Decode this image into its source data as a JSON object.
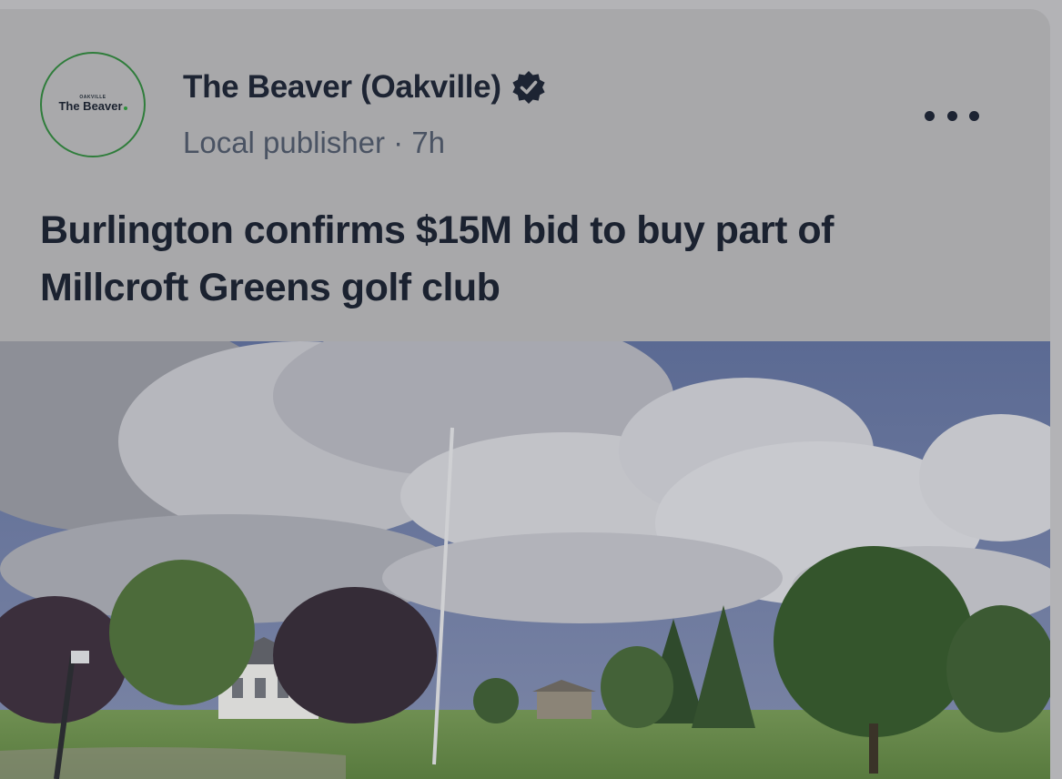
{
  "publisher": {
    "logo_small_text": "OAKVILLE",
    "logo_text": "The Beaver",
    "name": "The Beaver (Oakville)",
    "type": "Local publisher",
    "separator": "·",
    "time": "7h"
  },
  "post": {
    "headline": "Burlington confirms $15M bid to buy part of Millcroft Greens golf club"
  },
  "icons": {
    "verified": "verified-badge-icon",
    "more": "more-options-icon"
  },
  "colors": {
    "text_primary": "#1d2433",
    "text_secondary": "#4a5363",
    "logo_green": "#2f7d3b",
    "card_bg": "#a8a8aa"
  }
}
